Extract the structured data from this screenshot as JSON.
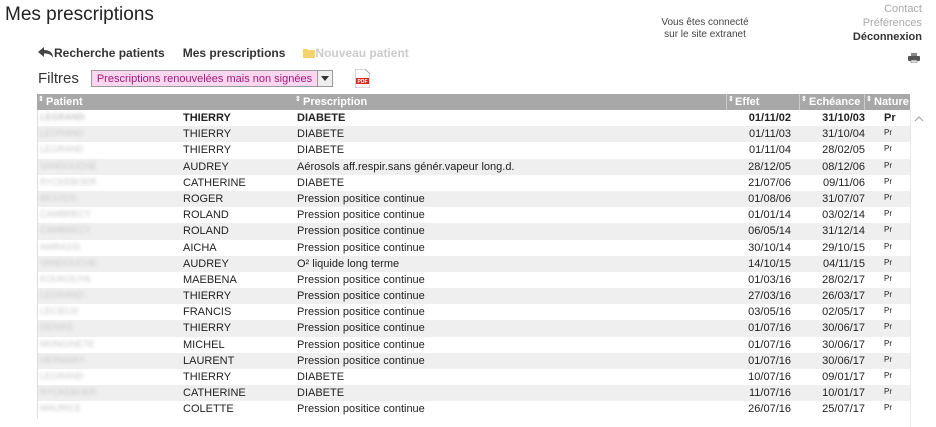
{
  "page": {
    "title": "Mes prescriptions"
  },
  "session": {
    "line1": "Vous êtes connecté",
    "line2": "sur le site extranet"
  },
  "top_links": {
    "contact": "Contact",
    "preferences": "Préférences",
    "deconnexion": "Déconnexion"
  },
  "nav": {
    "back": "Recherche patients",
    "current": "Mes prescriptions",
    "new": "Nouveau patient"
  },
  "filters": {
    "label": "Filtres",
    "selected": "Prescriptions renouvelées mais non signées"
  },
  "table": {
    "headers": {
      "patient": "Patient",
      "prescription": "Prescription",
      "effet": "Effet",
      "echeance": "Echéance",
      "nature": "Nature"
    },
    "rows": [
      {
        "patient": "LEGRAND",
        "prenom": "THIERRY",
        "prescription": "DIABETE",
        "effet": "01/11/02",
        "echeance": "31/10/03",
        "nature": "Pr"
      },
      {
        "patient": "LEGRAND",
        "prenom": "THIERRY",
        "prescription": "DIABETE",
        "effet": "01/11/03",
        "echeance": "31/10/04",
        "nature": "Pr"
      },
      {
        "patient": "LEGRAND",
        "prenom": "THIERRY",
        "prescription": "DIABETE",
        "effet": "01/11/04",
        "echeance": "28/02/05",
        "nature": "Pr"
      },
      {
        "patient": "VANDOUCHE",
        "prenom": "AUDREY",
        "prescription": "Aérosols aff.respir.sans génér.vapeur long.d.",
        "effet": "28/12/05",
        "echeance": "08/12/06",
        "nature": "Pr"
      },
      {
        "patient": "RYCKEBOER",
        "prenom": "CATHERINE",
        "prescription": "DIABETE",
        "effet": "21/07/06",
        "echeance": "09/11/06",
        "nature": "Pr"
      },
      {
        "patient": "BESTEN",
        "prenom": "ROGER",
        "prescription": "Pression positice continue",
        "effet": "01/08/06",
        "echeance": "31/07/07",
        "nature": "Pr"
      },
      {
        "patient": "CAMBRECY",
        "prenom": "ROLAND",
        "prescription": "Pression positice continue",
        "effet": "01/01/14",
        "echeance": "03/02/14",
        "nature": "Pr"
      },
      {
        "patient": "CAMBRECY",
        "prenom": "ROLAND",
        "prescription": "Pression positice continue",
        "effet": "06/05/14",
        "echeance": "31/12/14",
        "nature": "Pr"
      },
      {
        "patient": "AMRASSI",
        "prenom": "AICHA",
        "prescription": "Pression positice continue",
        "effet": "30/10/14",
        "echeance": "29/10/15",
        "nature": "Pr"
      },
      {
        "patient": "VANDOUCHE",
        "prenom": "AUDREY",
        "prescription": "O² liquide long terme",
        "effet": "14/10/15",
        "echeance": "04/11/15",
        "nature": "Pr"
      },
      {
        "patient": "KOUKOUYA",
        "prenom": "MAEBENA",
        "prescription": "Pression positice continue",
        "effet": "01/03/16",
        "echeance": "28/02/17",
        "nature": "Pr"
      },
      {
        "patient": "LEGRAND",
        "prenom": "THIERRY",
        "prescription": "Pression positice continue",
        "effet": "27/03/16",
        "echeance": "26/03/17",
        "nature": "Pr"
      },
      {
        "patient": "LECIEUX",
        "prenom": "FRANCIS",
        "prescription": "Pression positice continue",
        "effet": "03/05/16",
        "echeance": "02/05/17",
        "nature": "Pr"
      },
      {
        "patient": "DENIKE",
        "prenom": "THIERRY",
        "prescription": "Pression positice continue",
        "effet": "01/07/16",
        "echeance": "30/06/17",
        "nature": "Pr"
      },
      {
        "patient": "MONGINETE",
        "prenom": "MICHEL",
        "prescription": "Pression positice continue",
        "effet": "01/07/16",
        "echeance": "30/06/17",
        "nature": "Pr"
      },
      {
        "patient": "HERMARY",
        "prenom": "LAURENT",
        "prescription": "Pression positice continue",
        "effet": "01/07/16",
        "echeance": "30/06/17",
        "nature": "Pr"
      },
      {
        "patient": "LEGRAND",
        "prenom": "THIERRY",
        "prescription": "DIABETE",
        "effet": "10/07/16",
        "echeance": "09/01/17",
        "nature": "Pr"
      },
      {
        "patient": "RYCKEBOER",
        "prenom": "CATHERINE",
        "prescription": "DIABETE",
        "effet": "11/07/16",
        "echeance": "10/01/17",
        "nature": "Pr"
      },
      {
        "patient": "MAURICE",
        "prenom": "COLETTE",
        "prescription": "Pression positice continue",
        "effet": "26/07/16",
        "echeance": "25/07/17",
        "nature": "Pr"
      }
    ]
  },
  "colors": {
    "header_bg": "#a8a8a8",
    "select_bg": "#fbd7ef",
    "select_text": "#a0197a",
    "row_alt": "#efefef"
  },
  "icons": {
    "back": "arrow-back-icon",
    "folder": "folder-icon",
    "pdf": "pdf-icon",
    "printer": "printer-icon",
    "sort": "sort-icon",
    "dropdown": "chevron-down-icon",
    "scroll_up": "scroll-up-icon"
  }
}
